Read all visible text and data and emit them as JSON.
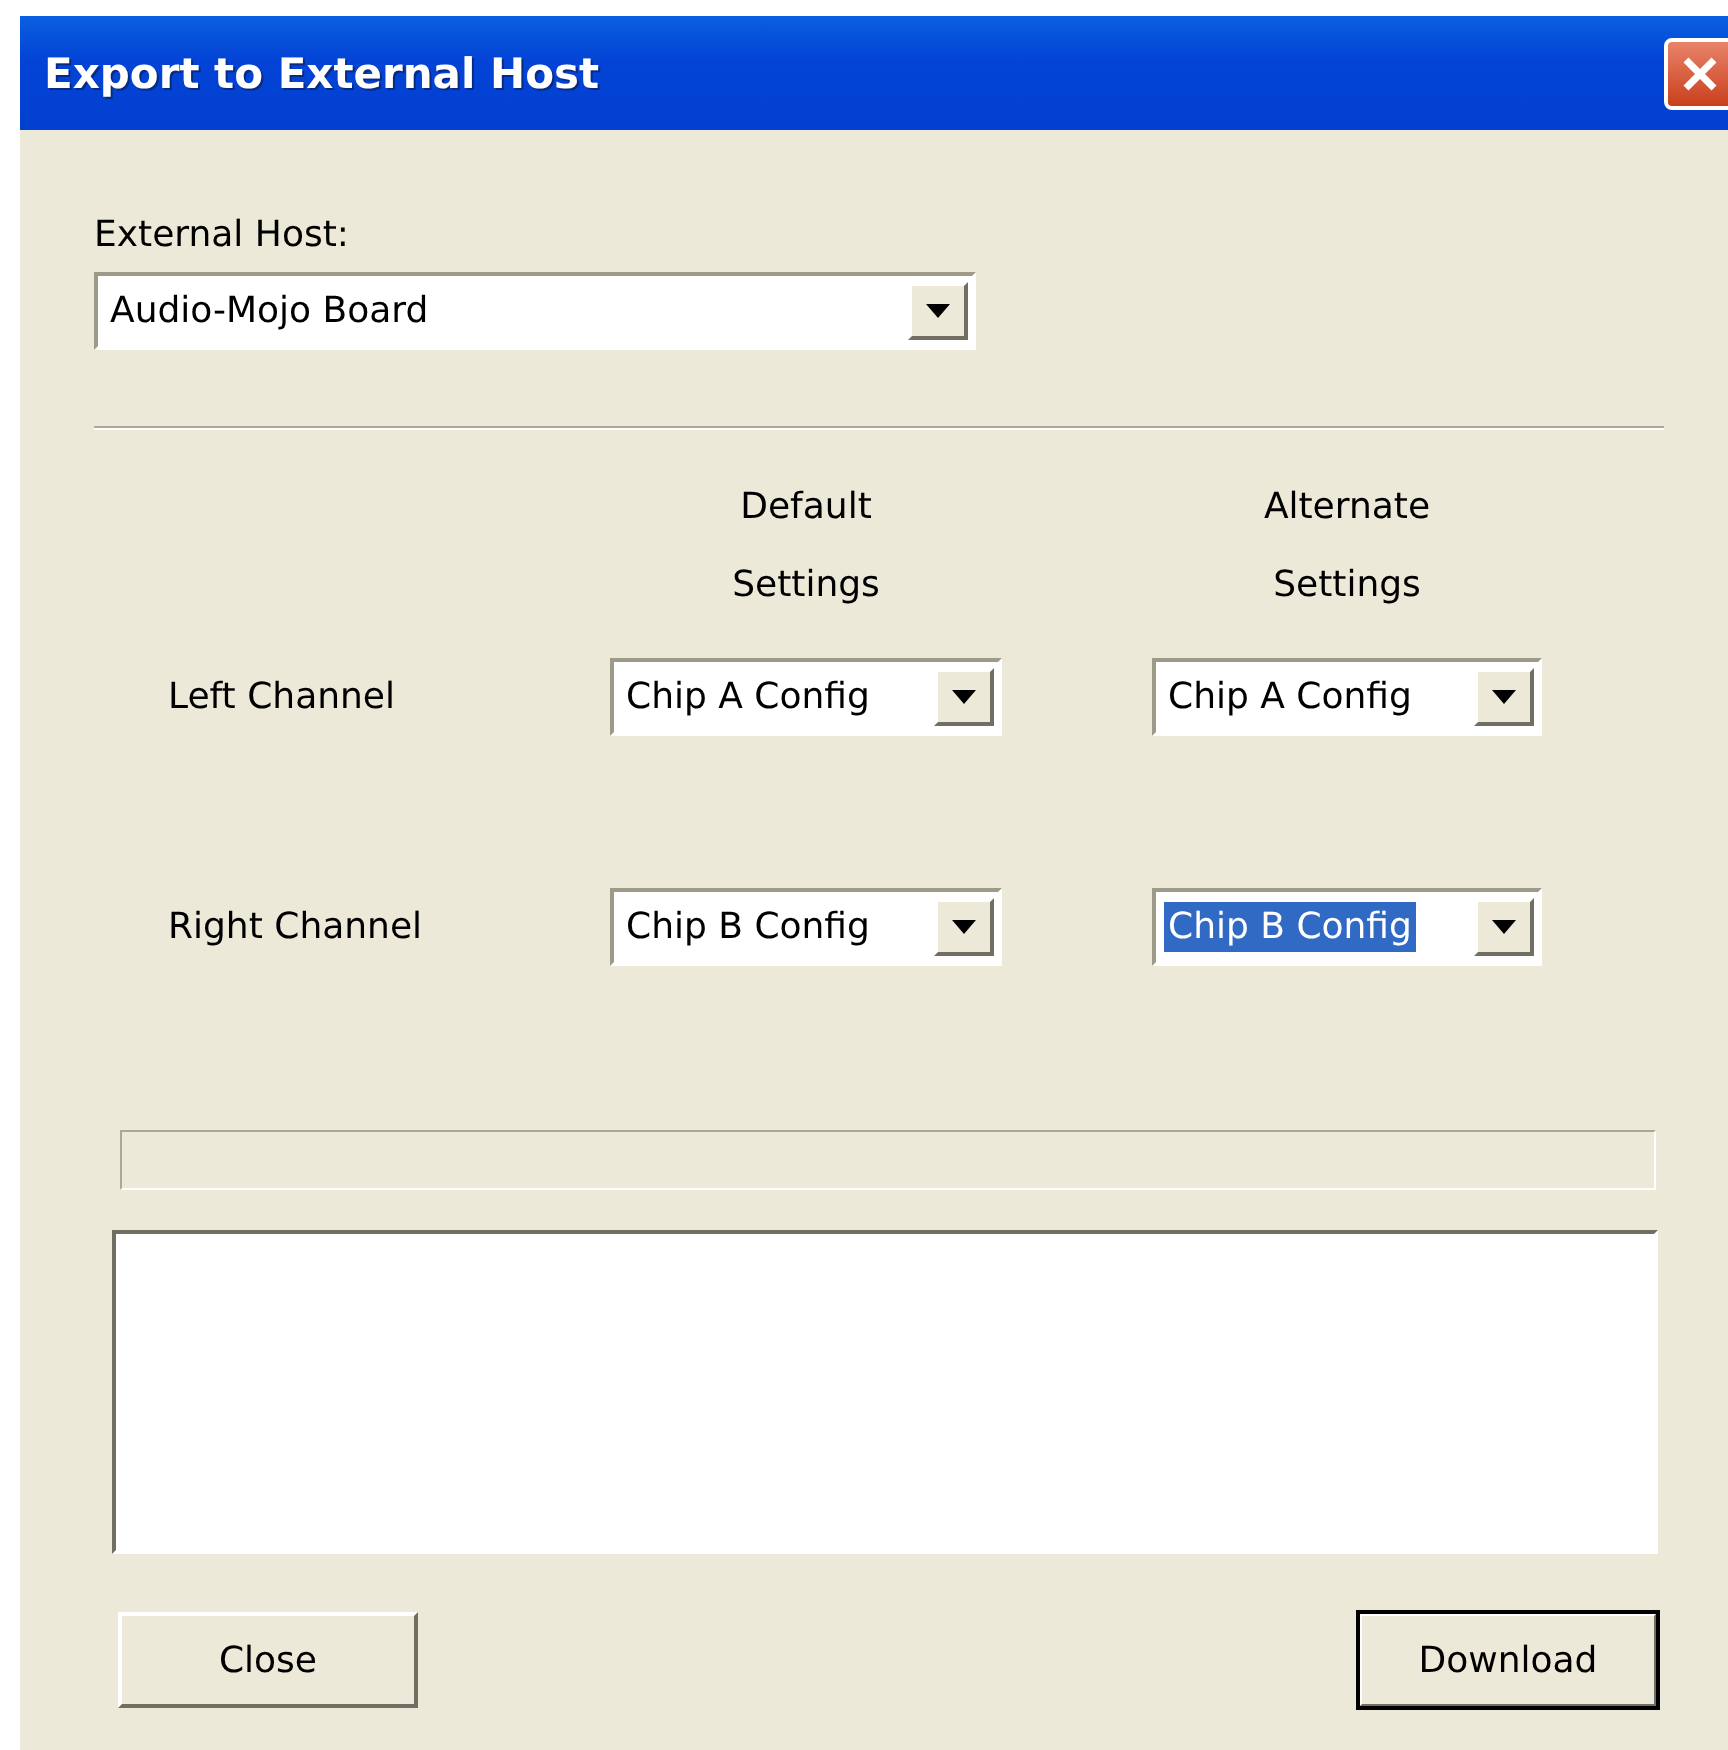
{
  "window": {
    "title": "Export to External Host"
  },
  "host": {
    "label": "External Host:",
    "value": "Audio-Mojo Board"
  },
  "columns": [
    {
      "lines": [
        "Default",
        "Settings"
      ]
    },
    {
      "lines": [
        "Alternate",
        "Settings"
      ]
    }
  ],
  "channels": [
    {
      "label": "Left Channel",
      "selects": [
        {
          "value": "Chip A Config",
          "focused": false
        },
        {
          "value": "Chip A Config",
          "focused": false
        }
      ]
    },
    {
      "label": "Right Channel",
      "selects": [
        {
          "value": "Chip B Config",
          "focused": false
        },
        {
          "value": "Chip B Config",
          "focused": true
        }
      ]
    }
  ],
  "progress": {
    "level": 0
  },
  "buttons": [
    {
      "label": "Close",
      "default": false
    },
    {
      "label": "Download",
      "default": true
    }
  ]
}
